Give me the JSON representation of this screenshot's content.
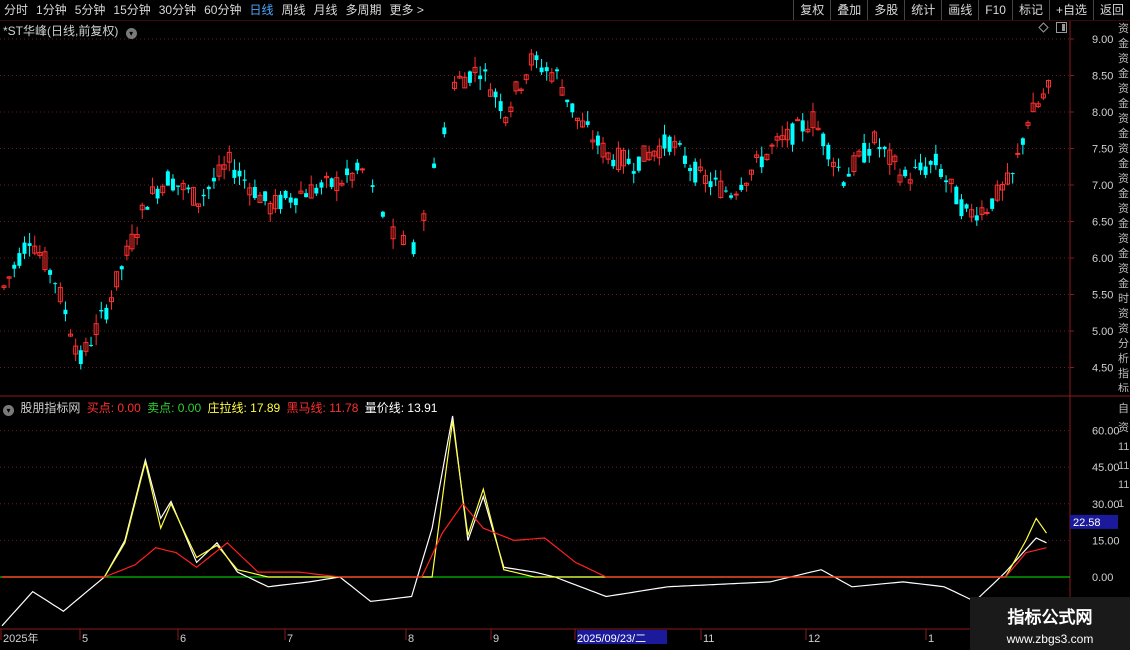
{
  "toolbar": {
    "periods": [
      "分时",
      "1分钟",
      "5分钟",
      "15分钟",
      "30分钟",
      "60分钟",
      "日线",
      "周线",
      "月线",
      "多周期",
      "更多 >"
    ],
    "active_period": "日线",
    "buttons": [
      "复权",
      "叠加",
      "多股",
      "统计",
      "画线",
      "F10",
      "标记",
      "+自选",
      "返回"
    ]
  },
  "main_chart": {
    "title": "*ST华峰(日线,前复权)",
    "price_axis": [
      "9.00",
      "8.50",
      "8.00",
      "7.50",
      "7.00",
      "6.50",
      "6.00",
      "5.50",
      "5.00",
      "4.50"
    ]
  },
  "indicator": {
    "name": "股朋指标网",
    "buy_label": "买点:",
    "buy_value": "0.00",
    "sell_label": "卖点:",
    "sell_value": "0.00",
    "zl_label": "庄拉线:",
    "zl_value": "17.89",
    "hm_label": "黑马线:",
    "hm_value": "11.78",
    "lj_label": "量价线:",
    "lj_value": "13.91",
    "axis": [
      "60.00",
      "45.00",
      "30.00",
      "15.00",
      "0.00"
    ],
    "current_marker": "22.58"
  },
  "date_axis": {
    "labels": [
      "2025年",
      "5",
      "6",
      "7",
      "8",
      "9",
      "2025/09/23/二",
      "11",
      "12",
      "1"
    ]
  },
  "watermark": {
    "line1": "指标公式网",
    "line2": "www.zbgs3.com"
  },
  "side_panel_text": "资金资金资金资金资金资金资金资金资金时资资分析指标收",
  "side_panel_text2": "自资1111111",
  "colors": {
    "up": "#ff3030",
    "down": "#00ffff",
    "grid": "#6a1a1a",
    "zl": "#ffff40",
    "hm": "#ff2020",
    "lj": "#ffffff",
    "zero": "#00c000"
  }
}
